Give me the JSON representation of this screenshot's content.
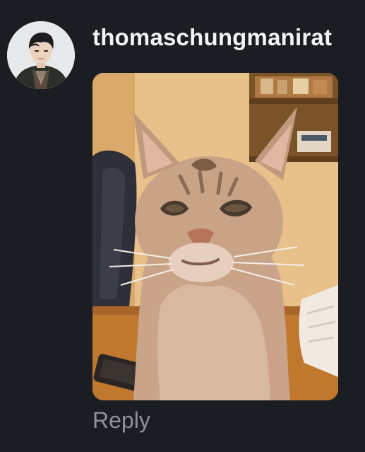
{
  "comment": {
    "username": "thomaschungmanirat",
    "avatar_icon": "profile-photo",
    "media_icon": "cat-gif",
    "reply_label": "Reply"
  },
  "colors": {
    "background": "#1a1d21",
    "username": "#f2f3f5",
    "reply": "#8e939b"
  }
}
